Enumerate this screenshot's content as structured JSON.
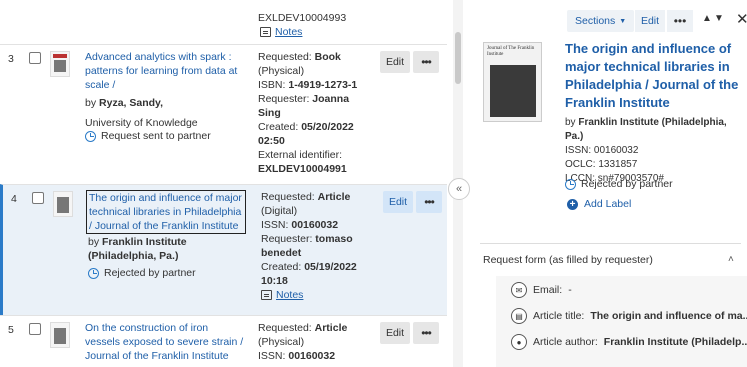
{
  "top": {
    "identifier": "EXLDEV10004993",
    "notes": "Notes"
  },
  "rows": [
    {
      "num": "3",
      "title": "Advanced analytics with spark : patterns for learning from data at scale /",
      "by_prefix": "by",
      "author": "Ryza, Sandy,",
      "publisher": "University of Knowledge",
      "status": "Request sent to partner",
      "requested_label": "Requested:",
      "requested_value": "Book",
      "requested_type": "(Physical)",
      "isbn_label": "ISBN:",
      "isbn": "1-4919-1273-1",
      "requester_label": "Requester:",
      "requester": "Joanna Sing",
      "created_label": "Created:",
      "created": "05/20/2022",
      "created_time": "02:50",
      "ext_label": "External identifier:",
      "ext_id": "EXLDEV10004991",
      "edit": "Edit",
      "more": "•••"
    },
    {
      "num": "4",
      "title": "The origin and influence of major technical libraries in Philadelphia / Journal of the Franklin Institute",
      "by_prefix": "by",
      "author": "Franklin Institute (Philadelphia, Pa.)",
      "status": "Rejected by partner",
      "requested_label": "Requested:",
      "requested_value": "Article",
      "requested_type": "(Digital)",
      "issn_label": "ISSN:",
      "issn": "00160032",
      "requester_label": "Requester:",
      "requester": "tomaso benedet",
      "created_label": "Created:",
      "created": "05/19/2022",
      "created_time": "10:18",
      "notes": "Notes",
      "edit": "Edit",
      "more": "•••"
    },
    {
      "num": "5",
      "title": "On the construction of iron vessels exposed to severe strain / Journal of the Franklin Institute",
      "requested_label": "Requested:",
      "requested_value": "Article",
      "requested_type": "(Physical)",
      "issn_label": "ISSN:",
      "issn": "00160032",
      "edit": "Edit",
      "more": "•••"
    }
  ],
  "detail": {
    "sections": "Sections",
    "edit": "Edit",
    "more": "•••",
    "cover_header": "Journal of The Franklin Institute",
    "title": "The origin and influence of major technical libraries in Philadelphia / Journal of the Franklin Institute",
    "by_prefix": "by",
    "author": "Franklin Institute (Philadelphia, Pa.)",
    "issn_line": "ISSN: 00160032",
    "oclc_line": "OCLC: 1331857",
    "lccn_line": "LCCN: sn#79003570#",
    "status": "Rejected by partner",
    "add_label": "Add Label",
    "request_form_label": "Request form (as filled by requester)",
    "fields": [
      {
        "icon": "email-icon",
        "label": "Email:",
        "value": "-"
      },
      {
        "icon": "book-icon",
        "label": "Article title:",
        "value": "The origin and influence of ma..."
      },
      {
        "icon": "person-icon",
        "label": "Article author:",
        "value": "Franklin Institute (Philadelp..."
      }
    ]
  }
}
